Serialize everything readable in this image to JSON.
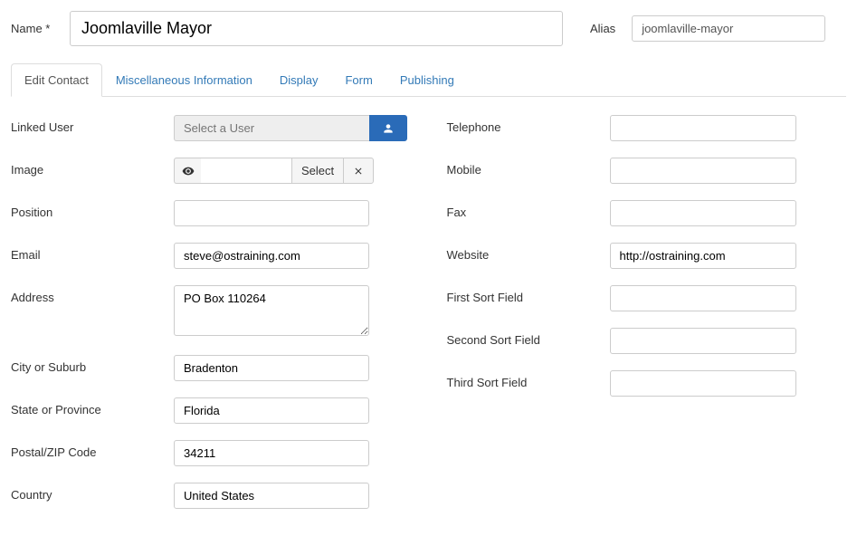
{
  "top": {
    "name_label": "Name *",
    "name_value": "Joomlaville Mayor",
    "alias_label": "Alias",
    "alias_value": "joomlaville-mayor"
  },
  "tabs": {
    "edit_contact": "Edit Contact",
    "misc_info": "Miscellaneous Information",
    "display": "Display",
    "form": "Form",
    "publishing": "Publishing"
  },
  "left": {
    "linked_user": {
      "label": "Linked User",
      "placeholder": "Select a User"
    },
    "image": {
      "label": "Image",
      "select_label": "Select",
      "clear_glyph": "✖",
      "preview_glyph": "👁"
    },
    "position": {
      "label": "Position",
      "value": ""
    },
    "email": {
      "label": "Email",
      "value": "steve@ostraining.com"
    },
    "address": {
      "label": "Address",
      "value": "PO Box 110264"
    },
    "city": {
      "label": "City or Suburb",
      "value": "Bradenton"
    },
    "state": {
      "label": "State or Province",
      "value": "Florida"
    },
    "postal": {
      "label": "Postal/ZIP Code",
      "value": "34211"
    },
    "country": {
      "label": "Country",
      "value": "United States"
    }
  },
  "right": {
    "telephone": {
      "label": "Telephone",
      "value": ""
    },
    "mobile": {
      "label": "Mobile",
      "value": ""
    },
    "fax": {
      "label": "Fax",
      "value": ""
    },
    "website": {
      "label": "Website",
      "value": "http://ostraining.com"
    },
    "first_sort": {
      "label": "First Sort Field",
      "value": ""
    },
    "second_sort": {
      "label": "Second Sort Field",
      "value": ""
    },
    "third_sort": {
      "label": "Third Sort Field",
      "value": ""
    }
  }
}
